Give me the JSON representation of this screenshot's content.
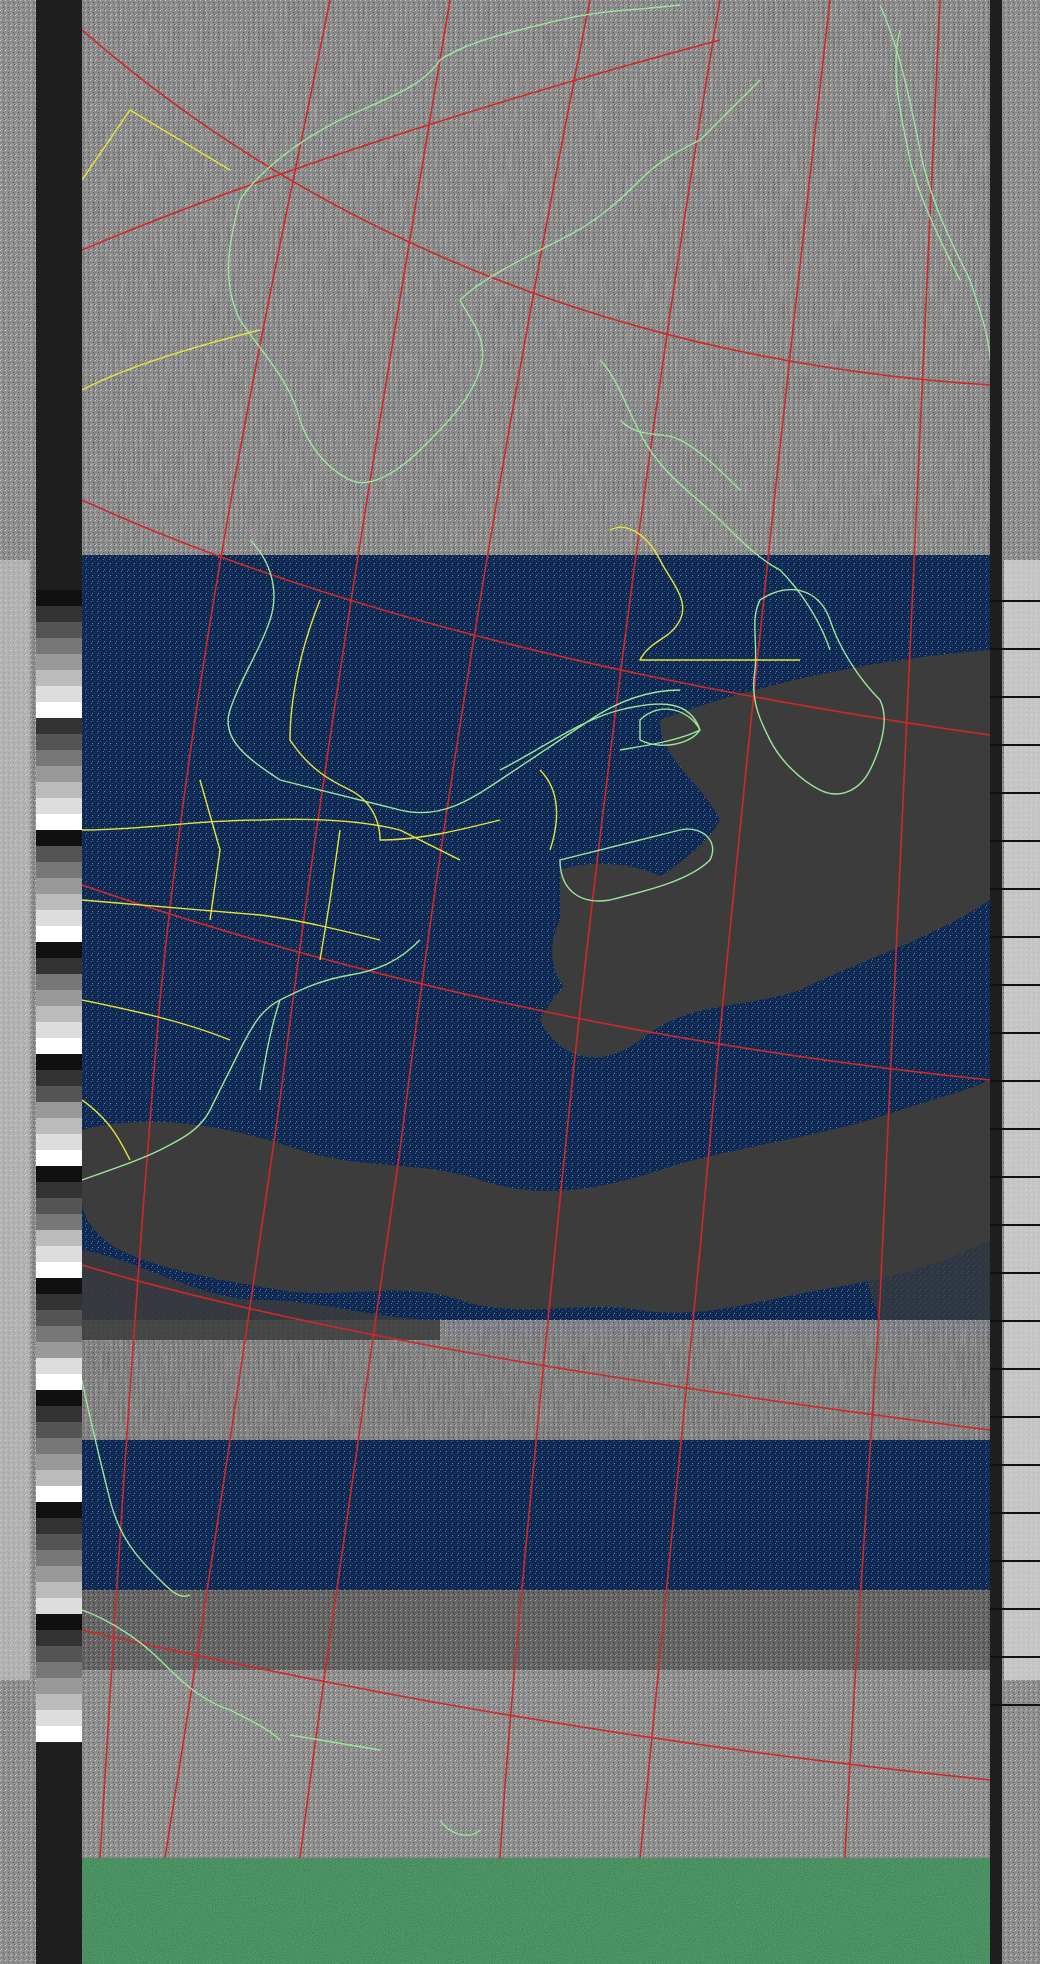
{
  "image": {
    "kind": "weather-satellite-apt-image",
    "channels": [
      "grayscale-calibration-strip-left",
      "map-image",
      "grayscale-calibration-strip-right"
    ],
    "regions": [
      "northeastern-north-america",
      "eastern-canada",
      "greenland",
      "north-atlantic-ocean",
      "caribbean"
    ]
  },
  "colors": {
    "ocean": "#0f2a52",
    "land_noise": "#8a8a8a",
    "cloud": "#3c3c3c",
    "coastline": "#9be59b",
    "borders": "#e7e23a",
    "graticule": "#d02828",
    "bottom_band": "#1d6b3a",
    "strip_dark": "#1a1a1a",
    "strip_light": "#d8d8d8"
  },
  "icons": {
    "coastline": "coastline-line",
    "border": "political-border-line",
    "graticule": "lat-lon-grid-line"
  }
}
